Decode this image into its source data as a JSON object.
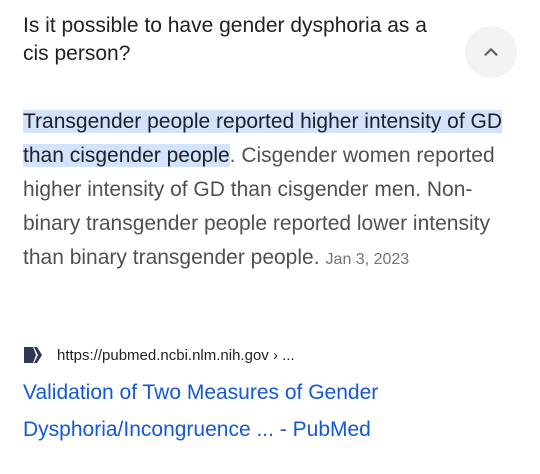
{
  "question": {
    "text": "Is it possible to have gender dysphoria as a cis person?"
  },
  "answer": {
    "highlight": "Transgender people reported higher intensity of GD than cisgender people",
    "rest": ". Cisgender women reported higher intensity of GD than cisgender men. Non-binary transgender people reported lower intensity than binary transgender people.",
    "date": "Jan 3, 2023"
  },
  "source": {
    "url": "https://pubmed.ncbi.nlm.nih.gov › ...",
    "icon": "pubmed-icon",
    "icon_color": "#2b3a52"
  },
  "result": {
    "title": "Validation of Two Measures of Gender Dysphoria/Incongruence ... - PubMed",
    "link_color": "#1558d6"
  },
  "controls": {
    "collapse_icon": "chevron-up-icon"
  }
}
